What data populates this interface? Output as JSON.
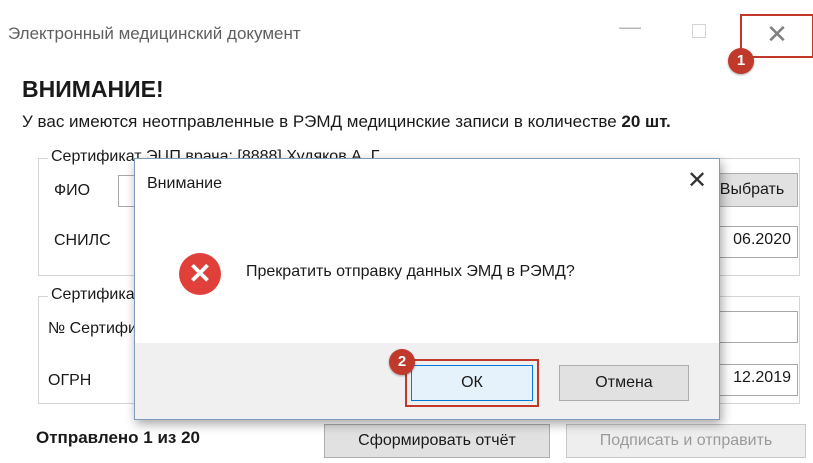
{
  "window": {
    "title": "Электронный медицинский документ",
    "minimize_glyph": "—",
    "close_glyph": "✕"
  },
  "annotations": {
    "badge1": "1",
    "badge2": "2",
    "color": "#c0392b"
  },
  "main": {
    "heading": "ВНИМАНИЕ!",
    "notice_text": "У вас имеются неотправленные в РЭМД медицинские записи в количестве ",
    "notice_count": "20 шт.",
    "cert_group": {
      "legend": "Сертификат ЭЦП врача: [8888] Худяков А. Г.",
      "fio_label": "ФИО",
      "fio_value": "",
      "select_button": "Выбрать",
      "snils_label": "СНИЛС",
      "snils_date": "06.2020"
    },
    "org_group": {
      "legend": "Сертификат ЭЦП МО",
      "cert_no_label": "№ Сертификата",
      "cert_no_value": "",
      "ogrn_label": "ОГРН",
      "ogrn_date": "12.2019"
    },
    "status": "Отправлено 1 из 20",
    "report_button": "Сформировать отчёт",
    "sign_button": "Подписать и отправить"
  },
  "dialog": {
    "title": "Внимание",
    "close_glyph": "✕",
    "icon": "error-icon",
    "icon_glyph": "✕",
    "message": "Прекратить отправку данных ЭМД в РЭМД?",
    "ok_label": "ОК",
    "cancel_label": "Отмена",
    "error_color": "#e0403a"
  }
}
